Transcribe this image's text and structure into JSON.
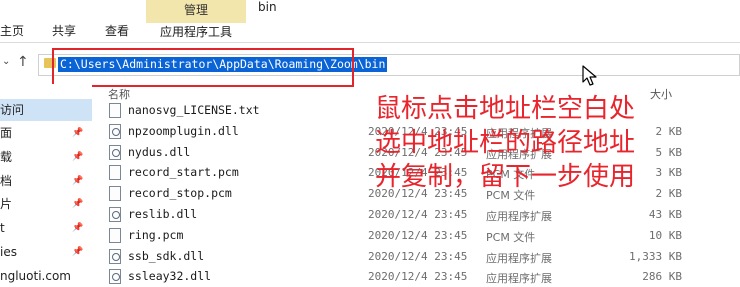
{
  "ribbon": {
    "tabs": [
      "主页",
      "共享",
      "查看"
    ],
    "context_group": "管理",
    "context_tab": "应用程序工具",
    "window_title": "bin"
  },
  "nav": {
    "up_arrow": "↑",
    "address": "C:\\Users\\Administrator\\AppData\\Roaming\\Zoom\\bin"
  },
  "sidebar": {
    "items": [
      {
        "label": "访问",
        "selected": true,
        "pinned": false
      },
      {
        "label": "面",
        "pinned": true
      },
      {
        "label": "载",
        "pinned": true
      },
      {
        "label": "档",
        "pinned": true
      },
      {
        "label": "片",
        "pinned": true
      },
      {
        "label": "t",
        "pinned": true
      },
      {
        "label": "ies",
        "pinned": true
      },
      {
        "label": "ngluoti.com",
        "pinned": false
      }
    ]
  },
  "list": {
    "header_name": "名称",
    "header_size": "大小",
    "files": [
      {
        "name": "nanosvg_LICENSE.txt",
        "date": "",
        "type": "",
        "size": "",
        "icon": "text"
      },
      {
        "name": "npzoomplugin.dll",
        "date": "2020/12/4 23:45",
        "type": "应用程序扩展",
        "size": "2 KB",
        "icon": "dll"
      },
      {
        "name": "nydus.dll",
        "date": "2020/12/4 23:45",
        "type": "应用程序扩展",
        "size": "5 KB",
        "icon": "dll"
      },
      {
        "name": "record_start.pcm",
        "date": "2020/12/4 23:45",
        "type": "PCM 文件",
        "size": "3 KB",
        "icon": "text"
      },
      {
        "name": "record_stop.pcm",
        "date": "2020/12/4 23:45",
        "type": "PCM 文件",
        "size": "2 KB",
        "icon": "text"
      },
      {
        "name": "reslib.dll",
        "date": "2020/12/4 23:45",
        "type": "应用程序扩展",
        "size": "43 KB",
        "icon": "dll"
      },
      {
        "name": "ring.pcm",
        "date": "2020/12/4 23:45",
        "type": "PCM 文件",
        "size": "10 KB",
        "icon": "text"
      },
      {
        "name": "ssb_sdk.dll",
        "date": "2020/12/4 23:45",
        "type": "应用程序扩展",
        "size": "1,333 KB",
        "icon": "dll"
      },
      {
        "name": "ssleay32.dll",
        "date": "2020/12/4 23:45",
        "type": "应用程序扩展",
        "size": "286 KB",
        "icon": "dll"
      }
    ]
  },
  "annotation": {
    "lines": [
      "鼠标点击地址栏空白处",
      "选中地址栏的路径地址",
      "并复制，留下一步使用"
    ],
    "color": "#e8242c"
  },
  "colors": {
    "selection": "#0a64d6",
    "highlight_box": "#e0262b",
    "context_tab": "#f3e6ad"
  }
}
